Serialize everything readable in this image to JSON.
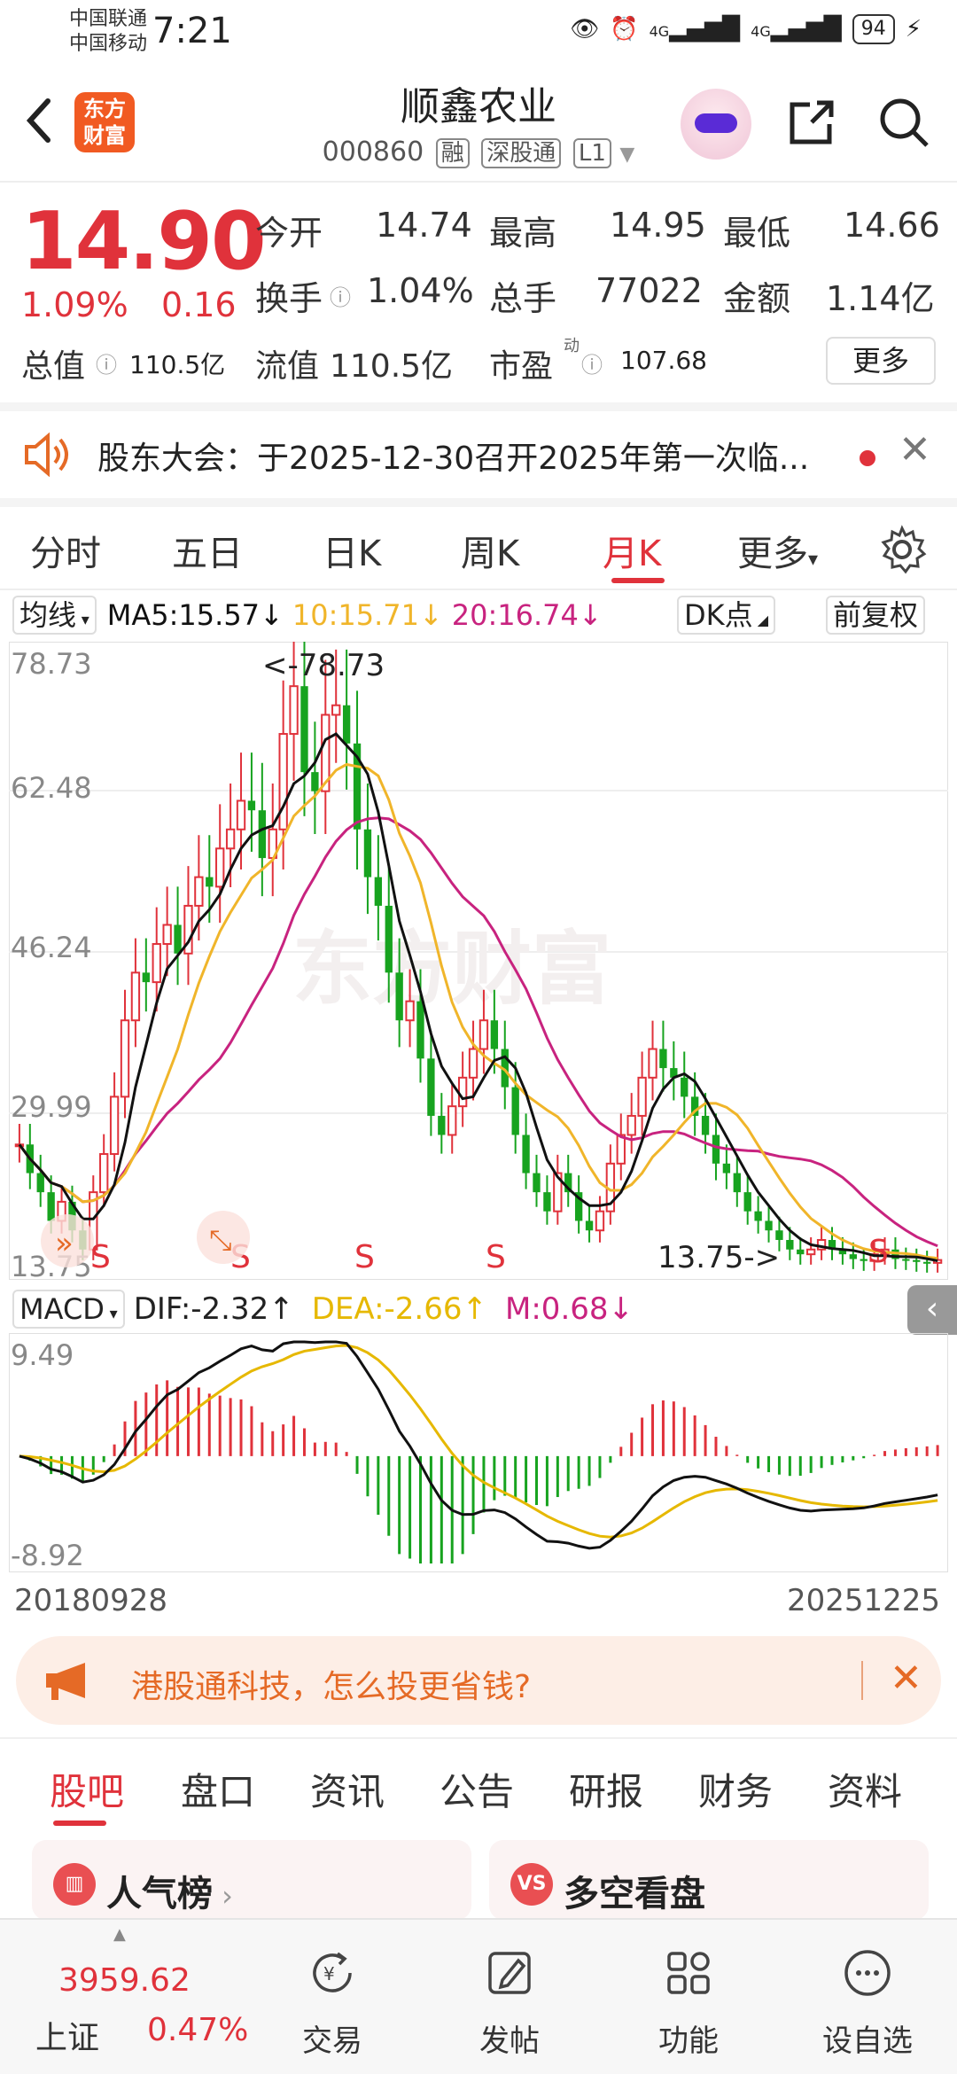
{
  "status": {
    "carrier1": "中国联通",
    "carrier2": "中国移动",
    "time": "7:21",
    "battery": "94",
    "net1": "4G",
    "net2": "4G"
  },
  "header": {
    "title": "顺鑫农业",
    "code": "000860",
    "tag1": "融",
    "tag2": "深股通",
    "tag3": "L1",
    "logo_line1": "东方",
    "logo_line2": "财富"
  },
  "quote": {
    "price": "14.90",
    "change_pct": "1.09%",
    "change_abs": "0.16",
    "open_label": "今开",
    "open": "14.74",
    "high_label": "最高",
    "high": "14.95",
    "low_label": "最低",
    "low": "14.66",
    "turnover_label": "换手",
    "turnover": "1.04%",
    "volume_label": "总手",
    "volume": "77022",
    "amount_label": "金额",
    "amount": "1.14亿",
    "mktcap_label": "总值",
    "mktcap": "110.5亿",
    "float_label": "流值",
    "float": "110.5亿",
    "pe_label": "市盈",
    "pe_sup": "动",
    "pe": "107.68",
    "more": "更多"
  },
  "notice": {
    "text": "股东大会：于2025-12-30召开2025年第一次临..."
  },
  "period_tabs": [
    "分时",
    "五日",
    "日K",
    "周K",
    "月K",
    "更多"
  ],
  "period_active": 4,
  "ma": {
    "label": "均线",
    "ma5": "MA5:15.57",
    "ma10": "10:15.71",
    "ma20": "20:16.74",
    "dk": "DK点",
    "adjust": "前复权"
  },
  "colors": {
    "up": "#e0323b",
    "down": "#17a31f",
    "ma5": "#111111",
    "ma10": "#f0b52a",
    "ma20": "#c8237f",
    "accent": "#f15a22"
  },
  "kchart": {
    "y_labels": [
      "78.73",
      "62.48",
      "46.24",
      "29.99",
      "13.75"
    ],
    "max_label": "<-78.73",
    "min_label": "13.75->",
    "s_marks": [
      "S",
      "S",
      "S",
      "S",
      "S"
    ],
    "watermark": "东方财富"
  },
  "macd": {
    "label": "MACD",
    "dif": "DIF:-2.32",
    "dea": "DEA:-2.66",
    "m": "M:0.68",
    "y_top": "9.49",
    "y_bottom": "-8.92"
  },
  "dates": {
    "start": "20180928",
    "end": "20251225"
  },
  "banner": {
    "text": "港股通科技，怎么投更省钱?"
  },
  "info_tabs": [
    "股吧",
    "盘口",
    "资讯",
    "公告",
    "研报",
    "财务",
    "资料"
  ],
  "cards": {
    "left": "人气榜",
    "right": "多空看盘",
    "right_icon": "VS"
  },
  "nav": {
    "index_value": "3959.62",
    "index_name": "上证",
    "index_pct": "0.47%",
    "items": [
      "交易",
      "发帖",
      "功能",
      "设自选"
    ]
  }
}
